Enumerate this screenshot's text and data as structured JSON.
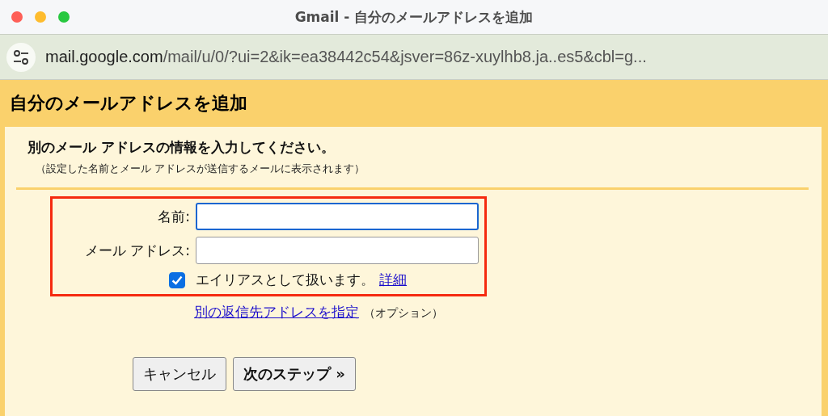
{
  "window": {
    "title": "Gmail - 自分のメールアドレスを追加"
  },
  "address_bar": {
    "domain": "mail.google.com",
    "path": "/mail/u/0/?ui=2&ik=ea38442c54&jsver=86z-xuylhb8.ja..es5&cbl=g..."
  },
  "dialog": {
    "title": "自分のメールアドレスを追加",
    "heading": "別のメール アドレスの情報を入力してください。",
    "note": "（設定した名前とメール アドレスが送信するメールに表示されます）"
  },
  "form": {
    "highlighted": true,
    "fields": [
      {
        "label": "名前:",
        "focused": true
      },
      {
        "label": "メール アドレス:",
        "focused": false
      }
    ],
    "alias": {
      "label": "エイリアスとして扱います。",
      "checked": true,
      "link": "詳細"
    }
  },
  "reply_to": {
    "link": "別の返信先アドレスを指定",
    "note": "（オプション）"
  },
  "buttons": [
    {
      "label": "キャンセル",
      "primary": false
    },
    {
      "label": "次のステップ »",
      "primary": true
    }
  ]
}
